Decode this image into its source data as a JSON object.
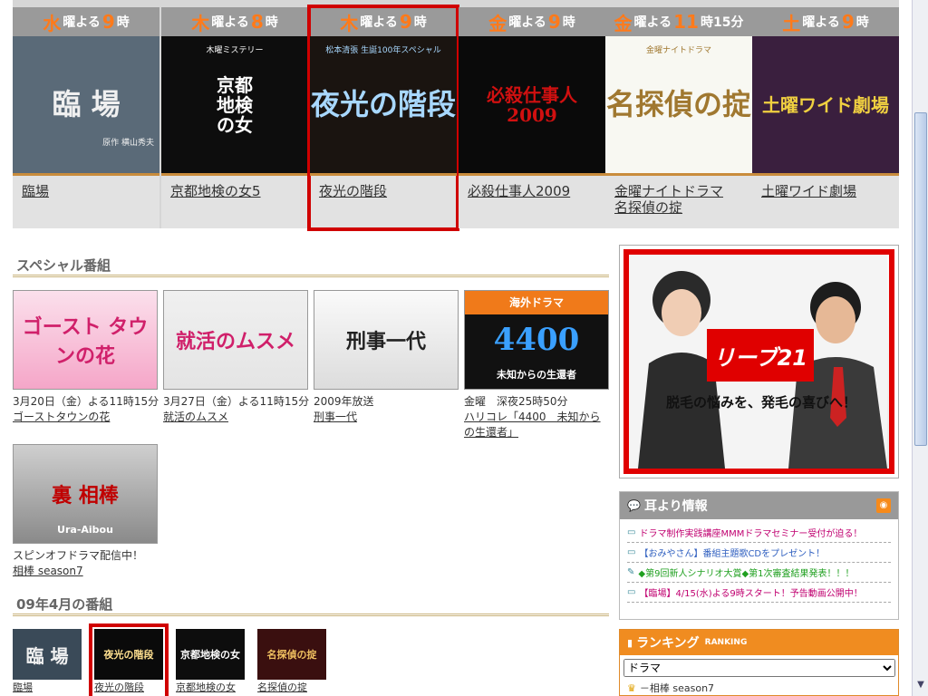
{
  "weekly": [
    {
      "day": "水",
      "suffix": "曜よる",
      "time": "9",
      "time_suffix": "時",
      "img_text": "臨 場",
      "img_sub": "原作 横山秀夫",
      "title": "臨場"
    },
    {
      "day": "木",
      "suffix": "曜よる",
      "time": "8",
      "time_suffix": "時",
      "img_text": "京都\n地検\nの女",
      "img_sub": "木曜ミステリー",
      "title": "京都地検の女5"
    },
    {
      "day": "木",
      "suffix": "曜よる",
      "time": "9",
      "time_suffix": "時",
      "img_text": "夜光の階段",
      "img_sub": "松本清張 生誕100年スペシャル",
      "title": "夜光の階段"
    },
    {
      "day": "金",
      "suffix": "曜よる",
      "time": "9",
      "time_suffix": "時",
      "img_text": "必殺仕事人 2009",
      "img_sub": "",
      "title": "必殺仕事人2009"
    },
    {
      "day": "金",
      "suffix": "曜よる",
      "time": "11",
      "time_suffix": "時15分",
      "img_text": "名探偵の掟",
      "img_sub": "金曜ナイトドラマ",
      "title": "金曜ナイトドラマ\n名探偵の掟"
    },
    {
      "day": "土",
      "suffix": "曜よる",
      "time": "9",
      "time_suffix": "時",
      "img_text": "土曜ワイド劇場",
      "img_sub": "",
      "title": "土曜ワイド劇場"
    }
  ],
  "special_header": "スペシャル番組",
  "specials": [
    {
      "date": "3月20日（金）よる11時15分",
      "title": "ゴーストタウンの花",
      "img_text": "ゴースト タウンの花"
    },
    {
      "date": "3月27日（金）よる11時15分",
      "title": "就活のムスメ",
      "img_text": "就活のムスメ"
    },
    {
      "date": "2009年放送",
      "title": "刑事一代",
      "img_text": "刑事一代"
    },
    {
      "date": "金曜　深夜25時50分",
      "title": "ハリコレ「4400　未知からの生還者」",
      "img_text": "4400",
      "img_sub": "未知からの生還者",
      "img_badge": "海外ドラマ"
    },
    {
      "date": "スピンオフドラマ配信中！",
      "title": "相棒 season7",
      "img_text": "裏 相棒",
      "img_sub": "Ura-Aibou"
    }
  ],
  "april_header": "09年4月の番組",
  "april": [
    {
      "title": "臨場",
      "img_text": "臨 場"
    },
    {
      "title": "夜光の階段",
      "img_text": "夜光の階段"
    },
    {
      "title": "京都地検の女",
      "img_text": "京都地検の女"
    },
    {
      "title": "名探偵の掟",
      "img_text": "名探偵の掟"
    }
  ],
  "ad": {
    "brand": "リーブ21",
    "tagline": "脱毛の悩みを、発毛の喜びへ！"
  },
  "news": {
    "title": "耳より情報",
    "items": [
      "ドラマ制作実践講座MMMドラマセミナー受付が迫る！",
      "【おみやさん】番組主題歌CDをプレゼント！",
      "◆第9回新人シナリオ大賞◆第1次審査結果発表！！！",
      "【臨場】4/15(水)よる9時スタート！予告動画公開中！"
    ]
  },
  "ranking": {
    "title": "ランキング",
    "title_en": "RANKING",
    "selected": "ドラマ",
    "first": "－相棒 season7"
  },
  "colors": {
    "accent": "#ff7a1a",
    "highlight": "#d00000",
    "rank": "#f08c20"
  }
}
